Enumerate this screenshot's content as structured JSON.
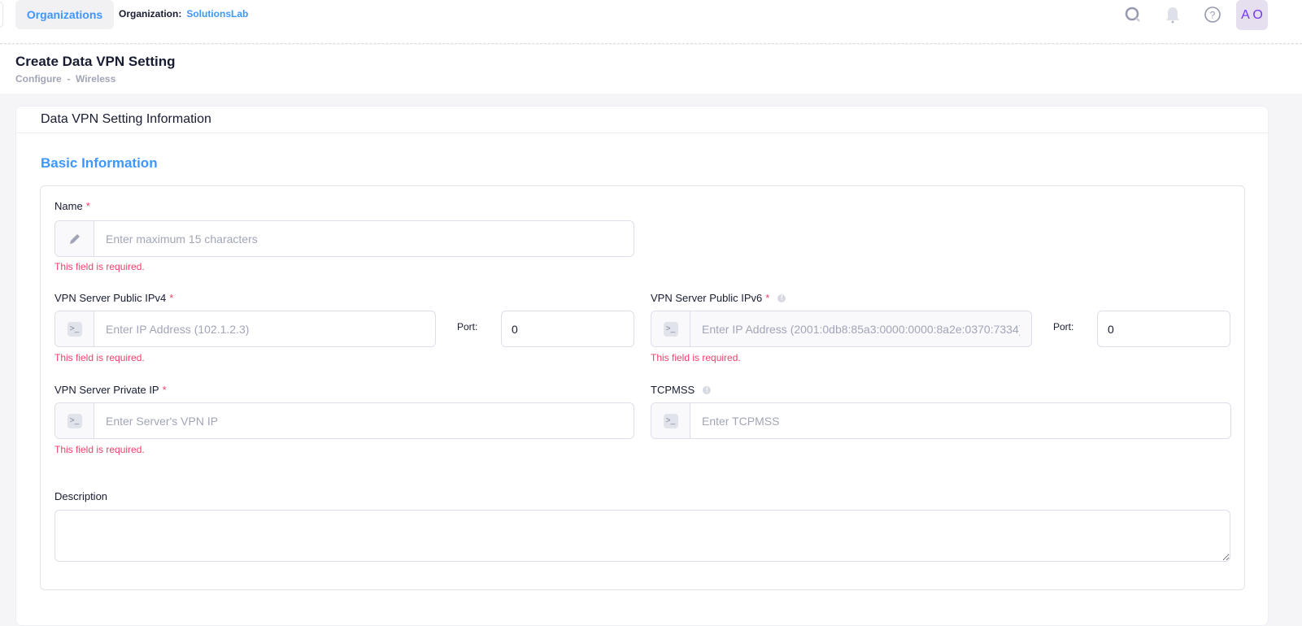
{
  "topbar": {
    "org_button": "Organizations",
    "org_label": "Organization:",
    "org_name": "SolutionsLab",
    "avatar_initials": "A O",
    "icons": [
      "search-icon",
      "bell-icon",
      "help-icon"
    ]
  },
  "header": {
    "title": "Create Data VPN Setting",
    "breadcrumb": "Configure  -  Wireless"
  },
  "card": {
    "title": "Data VPN Setting Information",
    "section": "Basic Information"
  },
  "form": {
    "required_mark": "*",
    "error": "This field is required.",
    "name": {
      "label": "Name",
      "placeholder": "Enter maximum 15 characters"
    },
    "ipv4": {
      "label": "VPN Server Public IPv4",
      "placeholder": "Enter IP Address (102.1.2.3)",
      "port_label": "Port:",
      "port_value": "0"
    },
    "ipv6": {
      "label": "VPN Server Public IPv6",
      "placeholder": "Enter IP Address (2001:0db8:85a3:0000:0000:8a2e:0370:7334)",
      "port_label": "Port:",
      "port_value": "0"
    },
    "private_ip": {
      "label": "VPN Server Private IP",
      "placeholder": "Enter Server's VPN IP"
    },
    "tcpmss": {
      "label": "TCPMSS",
      "placeholder": "Enter TCPMSS"
    },
    "description": {
      "label": "Description",
      "value": ""
    }
  },
  "colors": {
    "accent": "#3e97ff",
    "error": "#f1416c",
    "avatar_text": "#7239ea"
  }
}
